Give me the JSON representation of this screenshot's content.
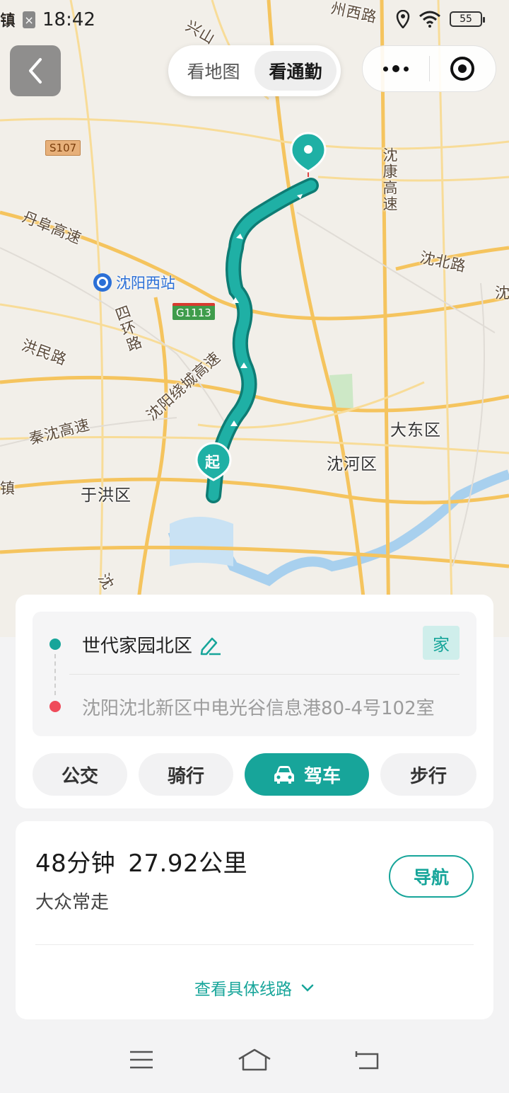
{
  "status": {
    "carrier_fragment": "镇",
    "time": "18:42",
    "battery": "55",
    "icons": [
      "notification-icon",
      "location-icon",
      "wifi-icon",
      "battery-icon"
    ]
  },
  "header": {
    "tabs": [
      {
        "label": "看地图",
        "active": false
      },
      {
        "label": "看通勤",
        "active": true
      }
    ]
  },
  "map": {
    "labels": {
      "xingshan_fragment": "兴山",
      "huangzhou": "州西路",
      "s107": "S107",
      "danfu": "丹阜高速",
      "xizhan": "沈阳西站",
      "sihuan": "四环路",
      "g1113": "G1113",
      "hongmin": "洪民路",
      "raocheng": "沈阳绕城高速",
      "qinshen": "秦沈高速",
      "yuhong": "于洪区",
      "shenhe": "沈河区",
      "dadong": "大东区",
      "shenkang": "沈康高速",
      "shenbei_road": "沈北路",
      "shen_fragment": "沈",
      "zhen_fragment": "镇",
      "shen_bottom": "沈"
    },
    "start_marker": "起",
    "accent": "#17a59a"
  },
  "route": {
    "from": "世代家园北区",
    "from_tag": "家",
    "to": "沈阳沈北新区中电光谷信息港80-4号102室",
    "modes": [
      {
        "label": "公交",
        "active": false
      },
      {
        "label": "骑行",
        "active": false
      },
      {
        "label": "驾车",
        "active": true
      },
      {
        "label": "步行",
        "active": false
      }
    ]
  },
  "result": {
    "duration": "48分钟",
    "distance": "27.92公里",
    "tag": "大众常走",
    "nav_label": "导航",
    "detail_label": "查看具体线路"
  }
}
